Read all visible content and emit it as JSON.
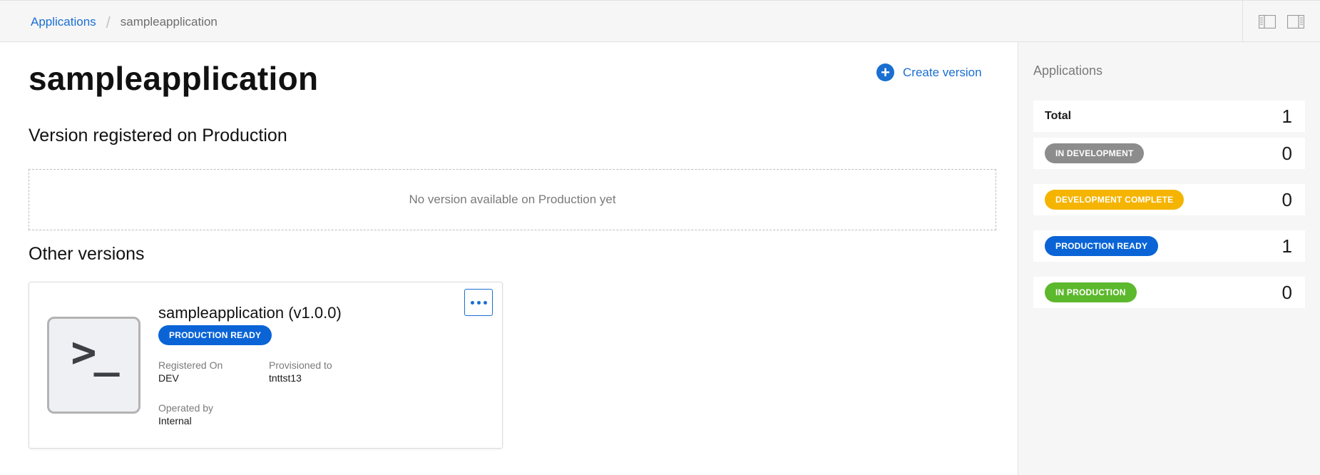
{
  "breadcrumb": {
    "root": "Applications",
    "separator": "/",
    "current": "sampleapplication"
  },
  "top_actions": {
    "left_panel_icon": "panel-left-icon",
    "right_panel_icon": "panel-right-icon"
  },
  "page": {
    "title": "sampleapplication",
    "create_version_label": "Create version",
    "create_version_icon": "plus-circle-icon",
    "production_section_title": "Version registered on Production",
    "production_empty_text": "No version available on Production yet",
    "other_section_title": "Other versions"
  },
  "version_card": {
    "icon": "terminal-icon",
    "icon_glyph": ">_",
    "title": "sampleapplication (v1.0.0)",
    "status": "PRODUCTION READY",
    "registered_on_label": "Registered On",
    "registered_on_value": "DEV",
    "provisioned_to_label": "Provisioned to",
    "provisioned_to_value": "tnttst13",
    "operated_by_label": "Operated by",
    "operated_by_value": "Internal",
    "menu_icon": "more-horizontal-icon"
  },
  "summary": {
    "title": "Applications",
    "rows": [
      {
        "label": "Total",
        "count": "1"
      },
      {
        "label": "IN DEVELOPMENT",
        "count": "0",
        "color": "#8c8c8c"
      },
      {
        "label": "DEVELOPMENT COMPLETE",
        "count": "0",
        "color": "#f5b400"
      },
      {
        "label": "PRODUCTION READY",
        "count": "1",
        "color": "#0a64d6"
      },
      {
        "label": "IN PRODUCTION",
        "count": "0",
        "color": "#5cb82c"
      }
    ]
  },
  "colors": {
    "accent": "#1a6fd1",
    "production_ready": "#0a64d6",
    "in_development": "#8c8c8c",
    "development_complete": "#f5b400",
    "in_production": "#5cb82c"
  }
}
